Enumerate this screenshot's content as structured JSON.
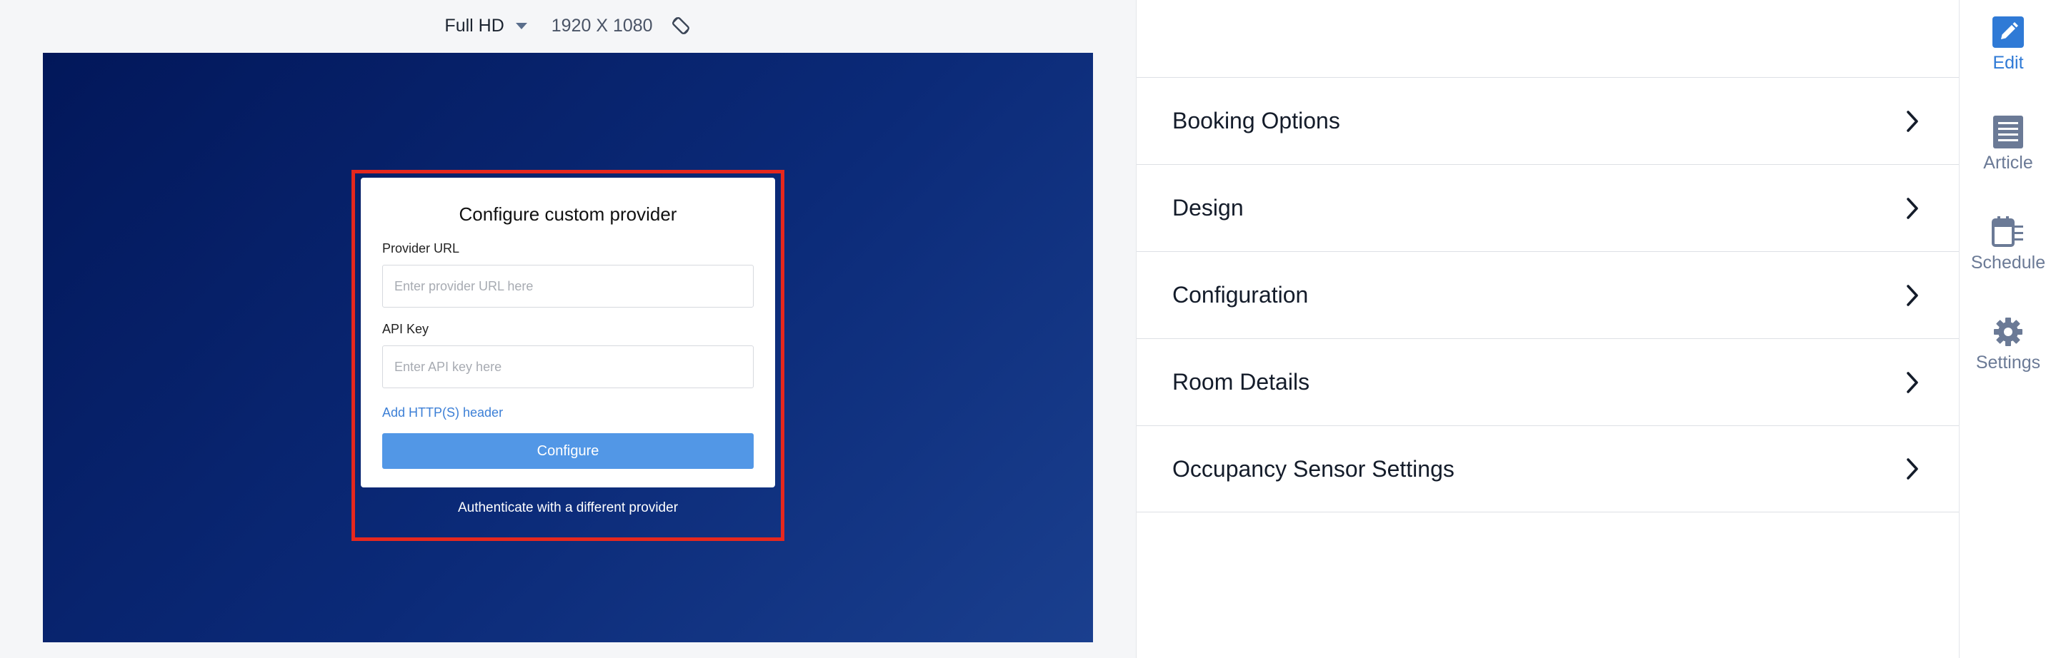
{
  "toolbar": {
    "resolution_name": "Full HD",
    "resolution_dims": "1920 X 1080"
  },
  "dialog": {
    "title": "Configure custom provider",
    "provider_url_label": "Provider URL",
    "provider_url_placeholder": "Enter provider URL here",
    "provider_url_value": "",
    "api_key_label": "API Key",
    "api_key_placeholder": "Enter API key here",
    "api_key_value": "",
    "add_header_link": "Add HTTP(S) header",
    "configure_button": "Configure",
    "alt_provider_link": "Authenticate with a different provider"
  },
  "settings": {
    "items": [
      {
        "label": "Booking Options"
      },
      {
        "label": "Design"
      },
      {
        "label": "Configuration"
      },
      {
        "label": "Room Details"
      },
      {
        "label": "Occupancy Sensor Settings"
      }
    ]
  },
  "sidebar": {
    "items": [
      {
        "label": "Edit",
        "icon": "edit-icon",
        "active": true
      },
      {
        "label": "Article",
        "icon": "article-icon",
        "active": false
      },
      {
        "label": "Schedule",
        "icon": "schedule-icon",
        "active": false
      },
      {
        "label": "Settings",
        "icon": "gear-icon",
        "active": false
      }
    ]
  },
  "colors": {
    "accent": "#2f7ad6",
    "button": "#5297e6",
    "screen_background": "#0b2a78",
    "highlight_border": "#e6281e",
    "sidebar_inactive": "#6b7a96"
  }
}
